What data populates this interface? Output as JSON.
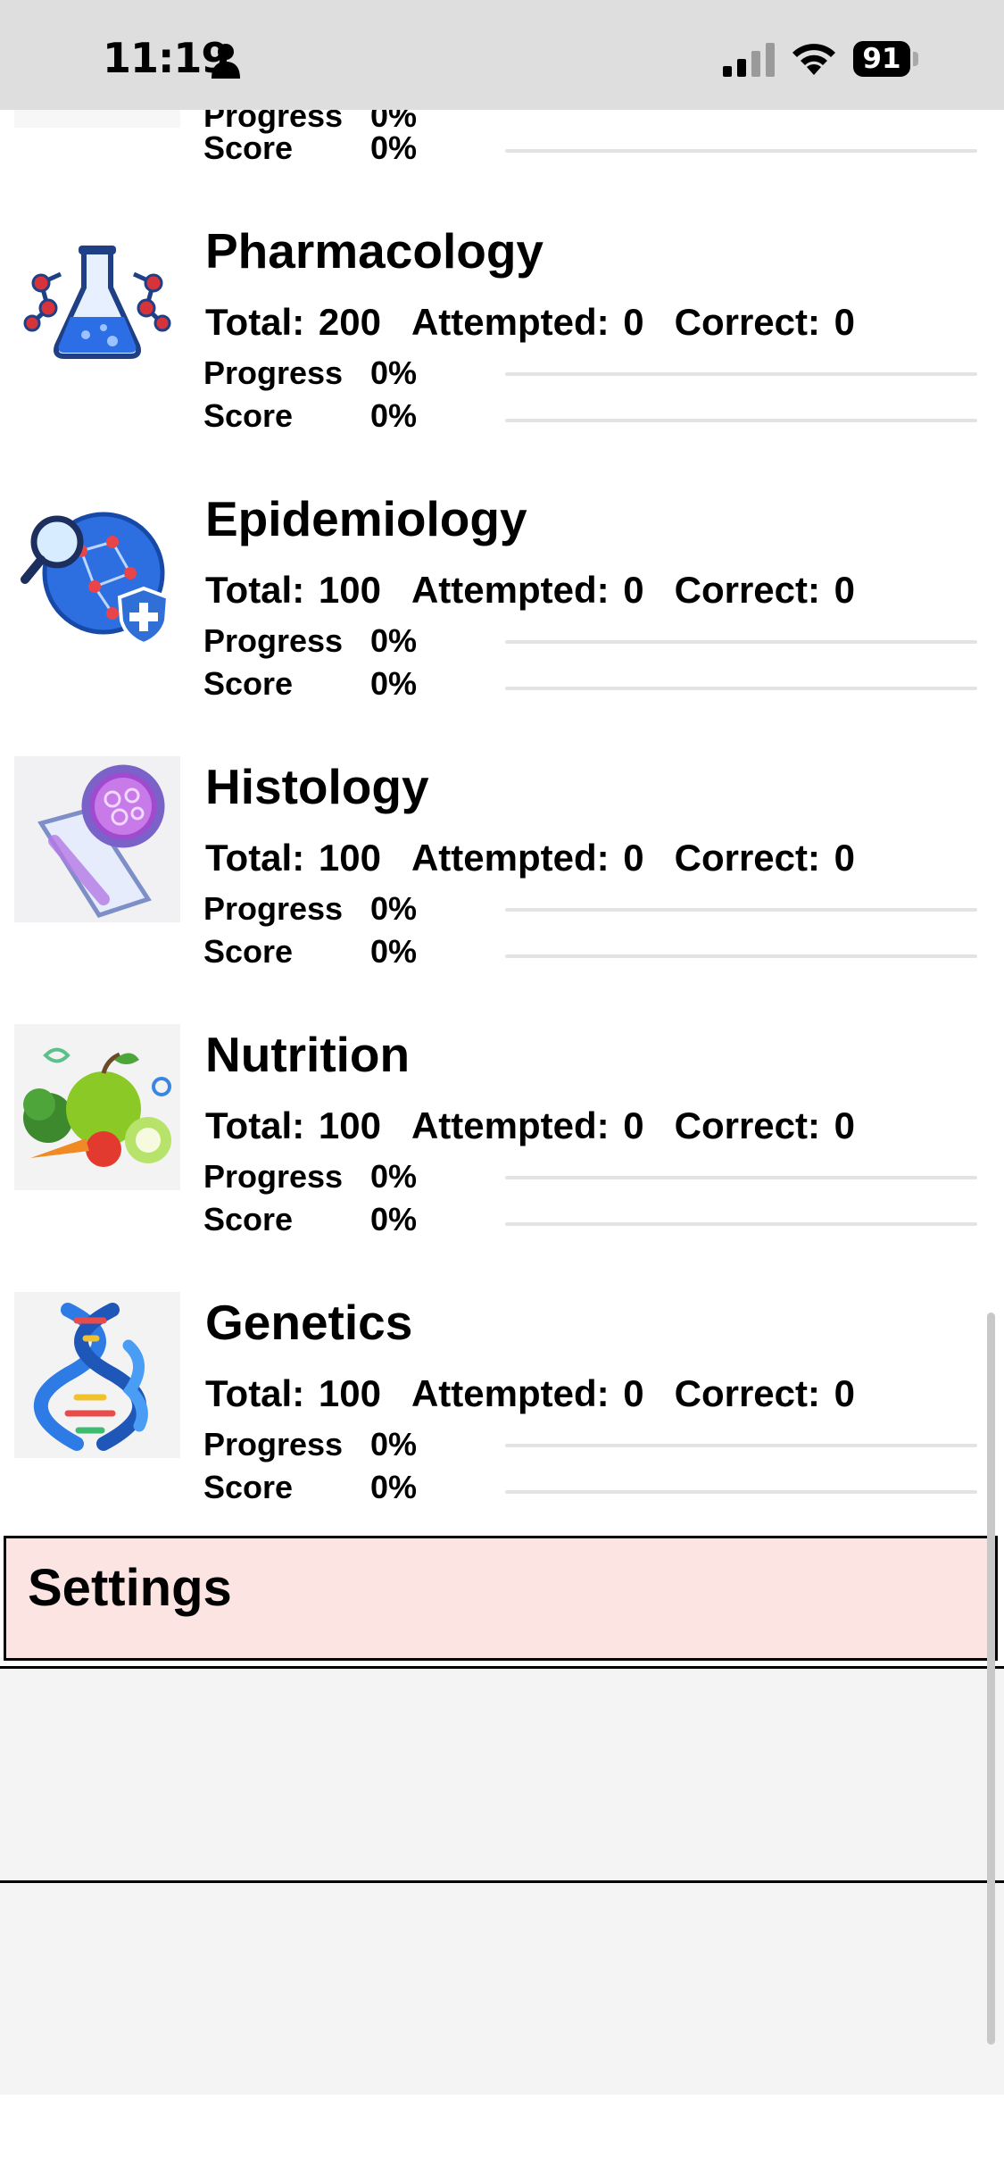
{
  "status_bar": {
    "time": "11:19",
    "battery": "91"
  },
  "top_partial": {
    "progress_label": "Progress",
    "progress_value": "0%",
    "score_label": "Score",
    "score_value": "0%"
  },
  "subjects": [
    {
      "name": "Pharmacology",
      "total": "Total: 200",
      "attempted": "Attempted: 0",
      "correct": "Correct: 0",
      "progress_label": "Progress",
      "progress_value": "0%",
      "score_label": "Score",
      "score_value": "0%",
      "progress": 0,
      "score": 0,
      "icon": "flask-molecule-icon"
    },
    {
      "name": "Epidemiology",
      "total": "Total: 100",
      "attempted": "Attempted: 0",
      "correct": "Correct: 0",
      "progress_label": "Progress",
      "progress_value": "0%",
      "score_label": "Score",
      "score_value": "0%",
      "progress": 0,
      "score": 0,
      "icon": "globe-magnifier-shield-icon"
    },
    {
      "name": "Histology",
      "total": "Total: 100",
      "attempted": "Attempted: 0",
      "correct": "Correct: 0",
      "progress_label": "Progress",
      "progress_value": "0%",
      "score_label": "Score",
      "score_value": "0%",
      "progress": 0,
      "score": 0,
      "icon": "microscope-slide-icon"
    },
    {
      "name": "Nutrition",
      "total": "Total: 100",
      "attempted": "Attempted: 0",
      "correct": "Correct: 0",
      "progress_label": "Progress",
      "progress_value": "0%",
      "score_label": "Score",
      "score_value": "0%",
      "progress": 0,
      "score": 0,
      "icon": "fruit-vegetables-icon"
    },
    {
      "name": "Genetics",
      "total": "Total: 100",
      "attempted": "Attempted: 0",
      "correct": "Correct: 0",
      "progress_label": "Progress",
      "progress_value": "0%",
      "score_label": "Score",
      "score_value": "0%",
      "progress": 0,
      "score": 0,
      "icon": "dna-helix-icon"
    }
  ],
  "settings": {
    "title": "Settings"
  },
  "colors": {
    "status_bar_bg": "#dedede",
    "settings_bg": "#fbe4e2",
    "track": "#e3e3e3"
  }
}
